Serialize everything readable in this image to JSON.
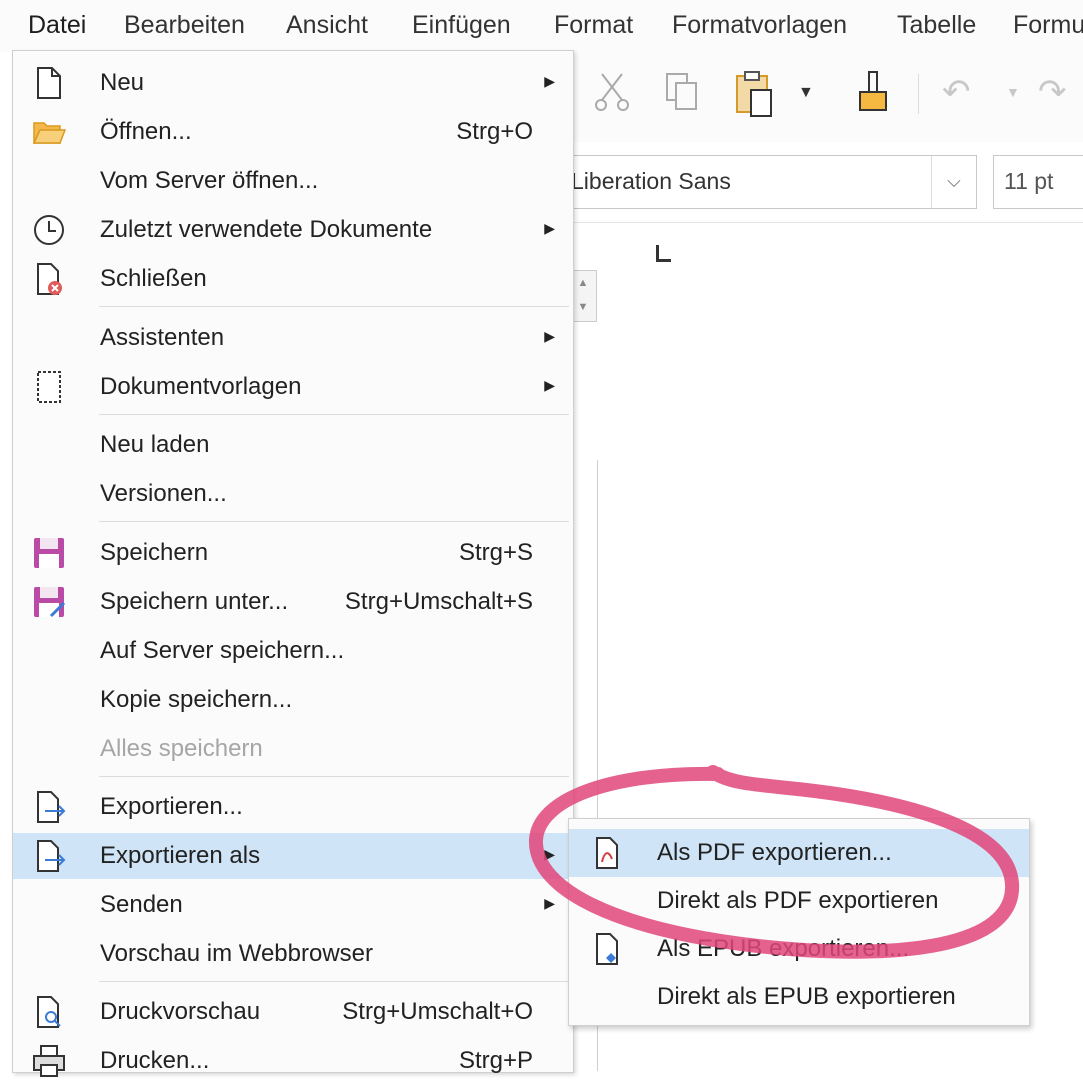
{
  "menubar": {
    "items": [
      "Datei",
      "Bearbeiten",
      "Ansicht",
      "Einfügen",
      "Format",
      "Formatvorlagen",
      "Tabelle",
      "Formu"
    ]
  },
  "toolbar": {
    "font_name": "Liberation Sans",
    "font_size": "11 pt"
  },
  "file_menu": {
    "new": {
      "label": "Neu"
    },
    "open": {
      "label": "Öffnen...",
      "shortcut": "Strg+O"
    },
    "open_remote": {
      "label": "Vom Server öffnen..."
    },
    "recent": {
      "label": "Zuletzt verwendete Dokumente"
    },
    "close": {
      "label": "Schließen"
    },
    "wizards": {
      "label": "Assistenten"
    },
    "templates": {
      "label": "Dokumentvorlagen"
    },
    "reload": {
      "label": "Neu laden"
    },
    "versions": {
      "label": "Versionen..."
    },
    "save": {
      "label": "Speichern",
      "shortcut": "Strg+S"
    },
    "save_as": {
      "label": "Speichern unter...",
      "shortcut": "Strg+Umschalt+S"
    },
    "save_remote": {
      "label": "Auf Server speichern..."
    },
    "save_copy": {
      "label": "Kopie speichern..."
    },
    "save_all": {
      "label": "Alles speichern"
    },
    "export": {
      "label": "Exportieren..."
    },
    "export_as": {
      "label": "Exportieren als"
    },
    "send": {
      "label": "Senden"
    },
    "preview_web": {
      "label": "Vorschau im Webbrowser"
    },
    "print_preview": {
      "label": "Druckvorschau",
      "shortcut": "Strg+Umschalt+O"
    },
    "print": {
      "label": "Drucken...",
      "shortcut": "Strg+P"
    }
  },
  "export_submenu": {
    "items": [
      {
        "label": "Als PDF exportieren..."
      },
      {
        "label": "Direkt als PDF exportieren"
      },
      {
        "label": "Als EPUB exportieren..."
      },
      {
        "label": "Direkt als EPUB exportieren"
      }
    ]
  },
  "colors": {
    "highlight": "#cfe4f7",
    "annotation": "#e0457a",
    "save_icon": "#b94aa6"
  }
}
